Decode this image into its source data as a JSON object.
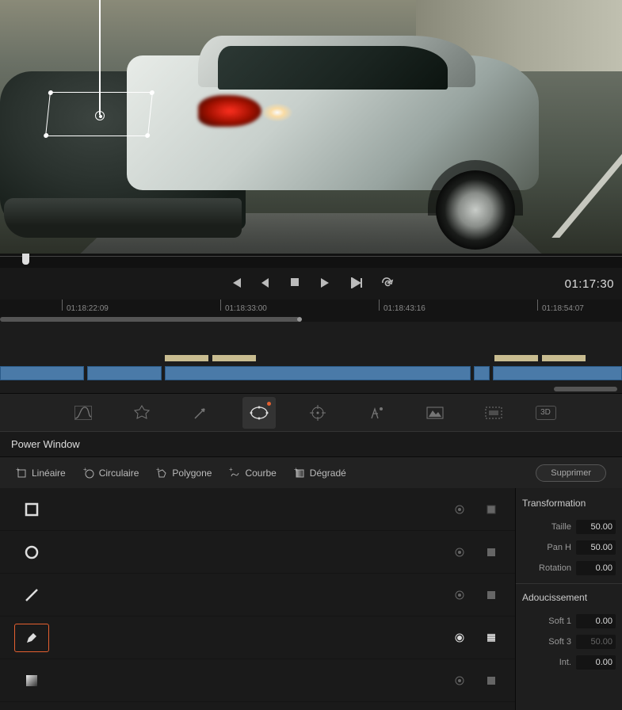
{
  "transport": {
    "timecode": "01:17:30"
  },
  "ruler": {
    "ticks": [
      {
        "pos": 78,
        "label": "01:18:22:09"
      },
      {
        "pos": 278,
        "label": "01:18:33:00"
      },
      {
        "pos": 478,
        "label": "01:18:43:16"
      },
      {
        "pos": 678,
        "label": "01:18:54:07"
      }
    ]
  },
  "tabs": {
    "threeDLabel": "3D"
  },
  "panel": {
    "title": "Power Window"
  },
  "shapeToolbar": {
    "linear": "Linéaire",
    "circle": "Circulaire",
    "polygon": "Polygone",
    "curve": "Courbe",
    "gradient": "Dégradé",
    "delete": "Supprimer"
  },
  "shapes": [
    {
      "icon": "rect",
      "active": false,
      "maskOn": false
    },
    {
      "icon": "circle",
      "active": false,
      "maskOn": false
    },
    {
      "icon": "line",
      "active": false,
      "maskOn": false
    },
    {
      "icon": "pen",
      "active": true,
      "maskOn": true
    },
    {
      "icon": "gradient",
      "active": false,
      "maskOn": false
    }
  ],
  "transform": {
    "title": "Transformation",
    "size": {
      "label": "Taille",
      "value": "50.00"
    },
    "panH": {
      "label": "Pan H",
      "value": "50.00"
    },
    "rotation": {
      "label": "Rotation",
      "value": "0.00"
    }
  },
  "softness": {
    "title": "Adoucissement",
    "soft1": {
      "label": "Soft 1",
      "value": "0.00"
    },
    "soft3": {
      "label": "Soft 3",
      "value": "50.00"
    },
    "int": {
      "label": "Int.",
      "value": "0.00"
    }
  }
}
